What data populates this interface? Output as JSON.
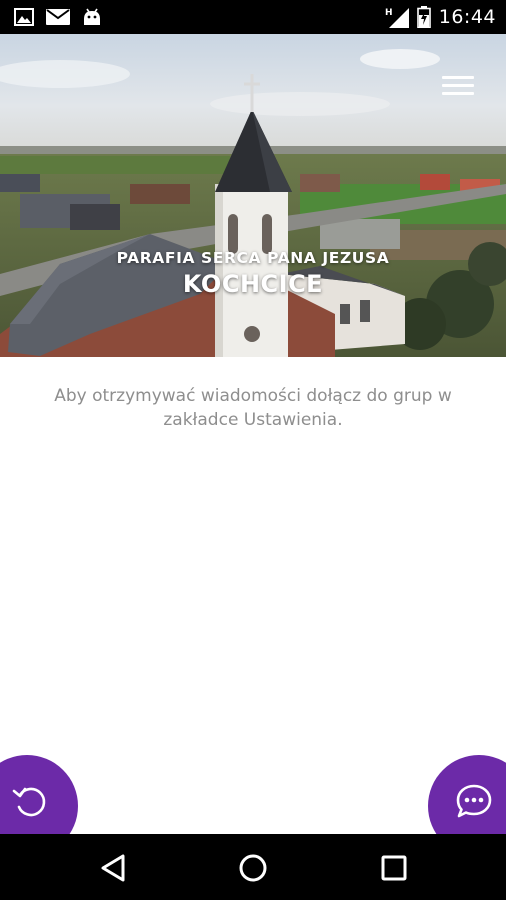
{
  "status_bar": {
    "time": "16:44",
    "left_icons": [
      "image-icon",
      "mail-icon",
      "android-icon"
    ],
    "right_icons": [
      "signal-icon",
      "battery-icon"
    ],
    "network_label": "H"
  },
  "header": {
    "menu_icon": "hamburger-menu-icon",
    "subtitle": "PARAFIA SERCA PANA JEZUSA",
    "title": "KOCHCICE"
  },
  "main": {
    "message": "Aby otrzymywać wiadomości dołącz do grup w zakładce Ustawienia."
  },
  "actions": {
    "refresh_icon": "refresh-icon",
    "chat_icon": "chat-bubble-icon"
  },
  "navigation": {
    "back_icon": "back-triangle-icon",
    "home_icon": "home-circle-icon",
    "recents_icon": "recents-square-icon"
  },
  "colors": {
    "accent": "#6c2aa8",
    "status_bar": "#000000",
    "message_text": "#8e8e8e"
  }
}
